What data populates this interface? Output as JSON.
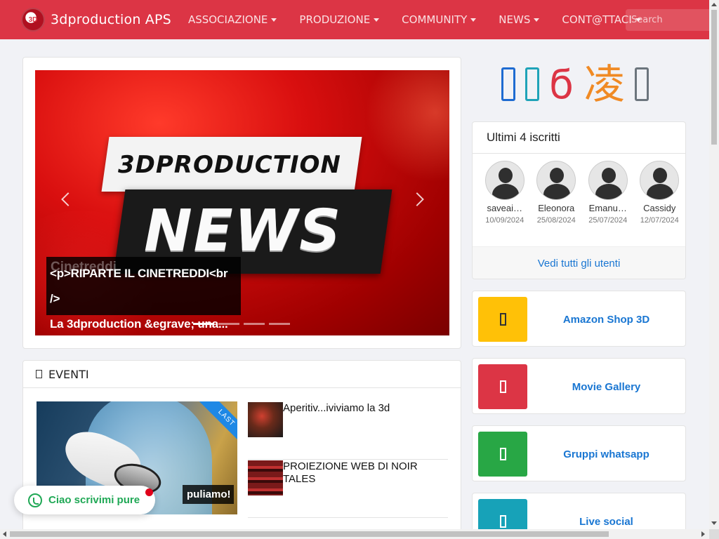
{
  "navbar": {
    "logo_text": "3D",
    "brand": "3dproduction APS",
    "menu": [
      {
        "label": "ASSOCIAZIONE"
      },
      {
        "label": "PRODUZIONE"
      },
      {
        "label": "COMMUNITY"
      },
      {
        "label": "NEWS"
      },
      {
        "label": "CONT@TTACI"
      }
    ],
    "search_placeholder": "Search"
  },
  "carousel": {
    "slide_text_1": "3DPRODUCTION",
    "slide_text_2": "NEWS",
    "caption_ghost": "Cinetreddi",
    "caption_line1": "<p>RIPARTE IL CINETREDDI<br />",
    "caption_line2": "La 3dproduction &egrave; una...",
    "indicator_count": 4,
    "active_index": 0
  },
  "events": {
    "header": "EVENTI",
    "featured_ribbon": "LAST",
    "featured_caption": "puliamo!",
    "items": [
      {
        "title": "Aperitiv...iviviamo la 3d"
      },
      {
        "title": "PROIEZIONE WEB DI NOIR TALES"
      }
    ]
  },
  "social": {
    "icons": [
      "facebook-icon",
      "twitter-icon",
      "instagram-icon",
      "chinese-char-icon",
      "youtube-icon"
    ],
    "glyphs": [
      "",
      "",
      "ϭ",
      "凌",
      ""
    ],
    "colors": [
      "#1e6bd1",
      "#1fa3b8",
      "#dc3545",
      "#f08a24",
      "#6c757d"
    ]
  },
  "members": {
    "title": "Ultimi 4 iscritti",
    "list": [
      {
        "name": "saveai…",
        "date": "10/09/2024"
      },
      {
        "name": "Eleonora",
        "date": "25/08/2024"
      },
      {
        "name": "Emanu…",
        "date": "25/07/2024"
      },
      {
        "name": "Cassidy",
        "date": "12/07/2024"
      }
    ],
    "footer_link": "Vedi tutti gli utenti"
  },
  "links": [
    {
      "label": "Amazon Shop 3D",
      "color": "#ffc107"
    },
    {
      "label": "Movie Gallery",
      "color": "#dc3545"
    },
    {
      "label": "Gruppi whatsapp",
      "color": "#28a745"
    },
    {
      "label": "Live social",
      "color": "#17a2b8"
    }
  ],
  "chat": {
    "label": "Ciao scrivimi pure"
  }
}
